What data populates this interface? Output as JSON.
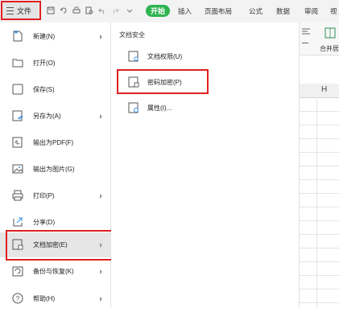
{
  "toolbar": {
    "file_label": "文件",
    "start_label": "开始",
    "tabs": [
      "插入",
      "页面布局",
      "公式",
      "数据",
      "审阅",
      "视"
    ]
  },
  "menu": {
    "items": [
      {
        "label": "新建(N)",
        "icon": "new-file-icon",
        "arrow": true
      },
      {
        "label": "打开(O)",
        "icon": "folder-icon",
        "arrow": false
      },
      {
        "label": "保存(S)",
        "icon": "save-icon",
        "arrow": false
      },
      {
        "label": "另存为(A)",
        "icon": "save-as-icon",
        "arrow": true
      },
      {
        "label": "输出为PDF(F)",
        "icon": "pdf-icon",
        "arrow": false
      },
      {
        "label": "输出为图片(G)",
        "icon": "image-icon",
        "arrow": false
      },
      {
        "label": "打印(P)",
        "icon": "printer-icon",
        "arrow": true
      },
      {
        "label": "分享(D)",
        "icon": "share-icon",
        "arrow": false
      },
      {
        "label": "文档加密(E)",
        "icon": "encrypt-icon",
        "arrow": true
      },
      {
        "label": "备份与恢复(K)",
        "icon": "backup-icon",
        "arrow": true
      },
      {
        "label": "帮助(H)",
        "icon": "help-icon",
        "arrow": true
      }
    ],
    "selected_index": 8
  },
  "submenu": {
    "title": "文档安全",
    "items": [
      {
        "label": "文档权限(U)",
        "icon": "doc-permission-icon"
      },
      {
        "label": "密码加密(P)",
        "icon": "password-encrypt-icon"
      },
      {
        "label": "属性(I)...",
        "icon": "properties-icon"
      }
    ]
  },
  "sheet": {
    "merge_label": "合并居",
    "column_header": "H"
  },
  "colors": {
    "highlight_border": "#e02020",
    "start_green": "#2fb350",
    "selected_bg": "#e6e6e6"
  }
}
